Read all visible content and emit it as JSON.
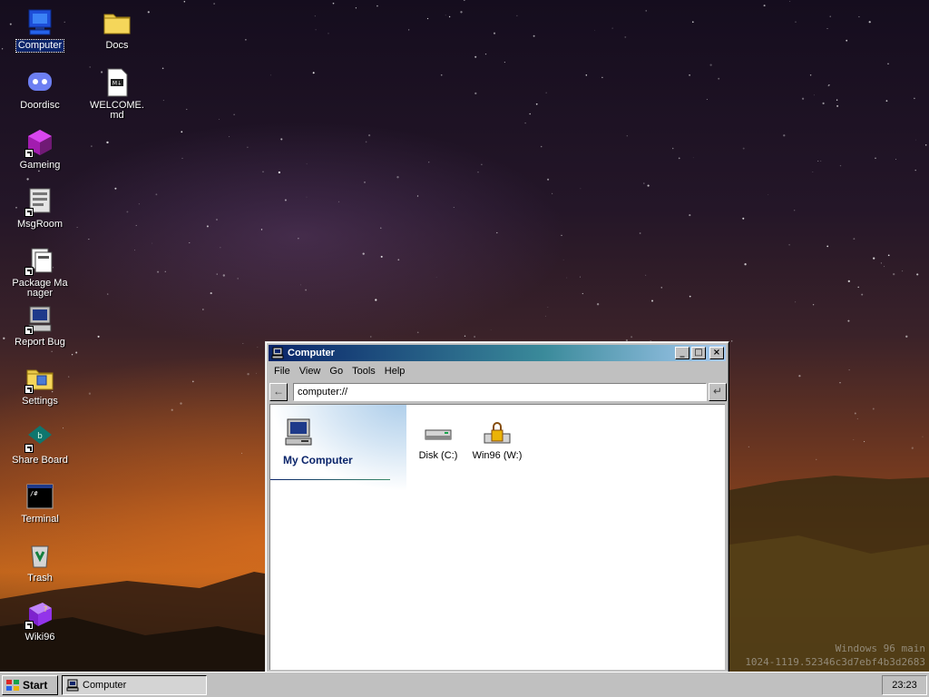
{
  "desktop": {
    "watermark_line1": "Windows 96 main",
    "watermark_line2": "1024-1119.52346c3d7ebf4b3d2683",
    "icons": [
      {
        "label": "Computer",
        "icon": "computer-icon"
      },
      {
        "label": "Docs",
        "icon": "folder-icon"
      },
      {
        "label": "Doordisc",
        "icon": "discord-icon"
      },
      {
        "label": "WELCOME.md",
        "icon": "markdown-file-icon"
      },
      {
        "label": "Gameing",
        "icon": "game-cube-icon"
      },
      {
        "label": "MsgRoom",
        "icon": "chat-icon"
      },
      {
        "label": "Package Manager",
        "icon": "package-icon"
      },
      {
        "label": "Report Bug",
        "icon": "bug-report-icon"
      },
      {
        "label": "Settings",
        "icon": "settings-folder-icon"
      },
      {
        "label": "Share Board",
        "icon": "share-board-icon"
      },
      {
        "label": "Terminal",
        "icon": "terminal-icon"
      },
      {
        "label": "Trash",
        "icon": "trash-icon"
      },
      {
        "label": "Wiki96",
        "icon": "wiki-book-icon"
      }
    ]
  },
  "window": {
    "title": "Computer",
    "menu": [
      "File",
      "View",
      "Go",
      "Tools",
      "Help"
    ],
    "back_button": "←",
    "go_button": "↵",
    "address": "computer://",
    "sidebar_title": "My Computer",
    "drives": [
      {
        "label": "Disk (C:)",
        "icon": "hard-disk-icon"
      },
      {
        "label": "Win96 (W:)",
        "icon": "locked-drive-icon"
      }
    ],
    "buttons": {
      "minimize": "_",
      "maximize": "□",
      "close": "×"
    }
  },
  "taskbar": {
    "start_label": "Start",
    "tasks": [
      {
        "label": "Computer"
      }
    ],
    "clock": "23:23"
  },
  "colors": {
    "titlebar_start": "#0a246a",
    "titlebar_end": "#a6caf0",
    "face": "#c0c0c0",
    "selection": "#0a246a"
  }
}
